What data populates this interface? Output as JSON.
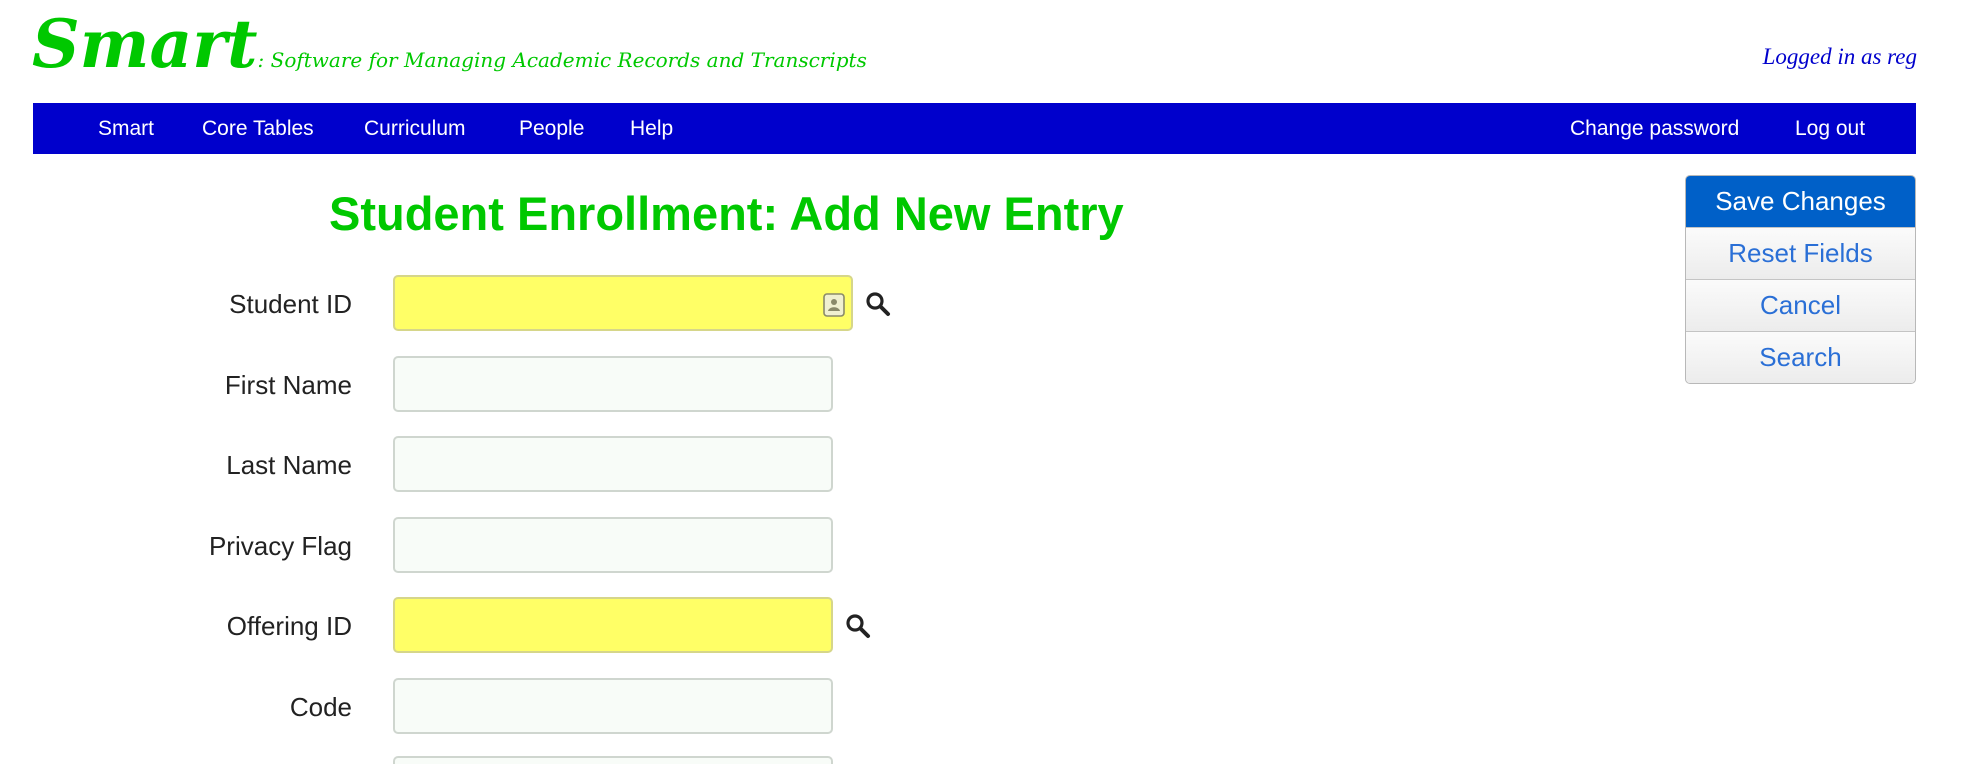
{
  "header": {
    "brand_name": "Smart",
    "brand_subtitle": ": Software for Managing Academic Records and Transcripts",
    "login_status": "Logged in as reg"
  },
  "nav": {
    "left": [
      "Smart",
      "Core Tables",
      "Curriculum",
      "People",
      "Help"
    ],
    "right": [
      "Change password",
      "Log out"
    ]
  },
  "page_title": "Student Enrollment: Add New Entry",
  "actions": {
    "save": "Save Changes",
    "reset": "Reset Fields",
    "cancel": "Cancel",
    "search": "Search"
  },
  "form": {
    "fields": [
      {
        "label": "Student ID",
        "value": "",
        "required": true,
        "lookup": true
      },
      {
        "label": "First Name",
        "value": "",
        "required": false,
        "lookup": false
      },
      {
        "label": "Last Name",
        "value": "",
        "required": false,
        "lookup": false
      },
      {
        "label": "Privacy Flag",
        "value": "",
        "required": false,
        "lookup": false
      },
      {
        "label": "Offering ID",
        "value": "",
        "required": true,
        "lookup": true
      },
      {
        "label": "Code",
        "value": "",
        "required": false,
        "lookup": false
      }
    ]
  },
  "colors": {
    "brand_green": "#00c800",
    "nav_blue": "#0000cc",
    "required_yellow": "#ffff66",
    "primary_button": "#0060c8",
    "link_blue": "#2a6fd6"
  },
  "icons": {
    "lookup": "search-icon",
    "contact_card": "contact-card-icon"
  }
}
